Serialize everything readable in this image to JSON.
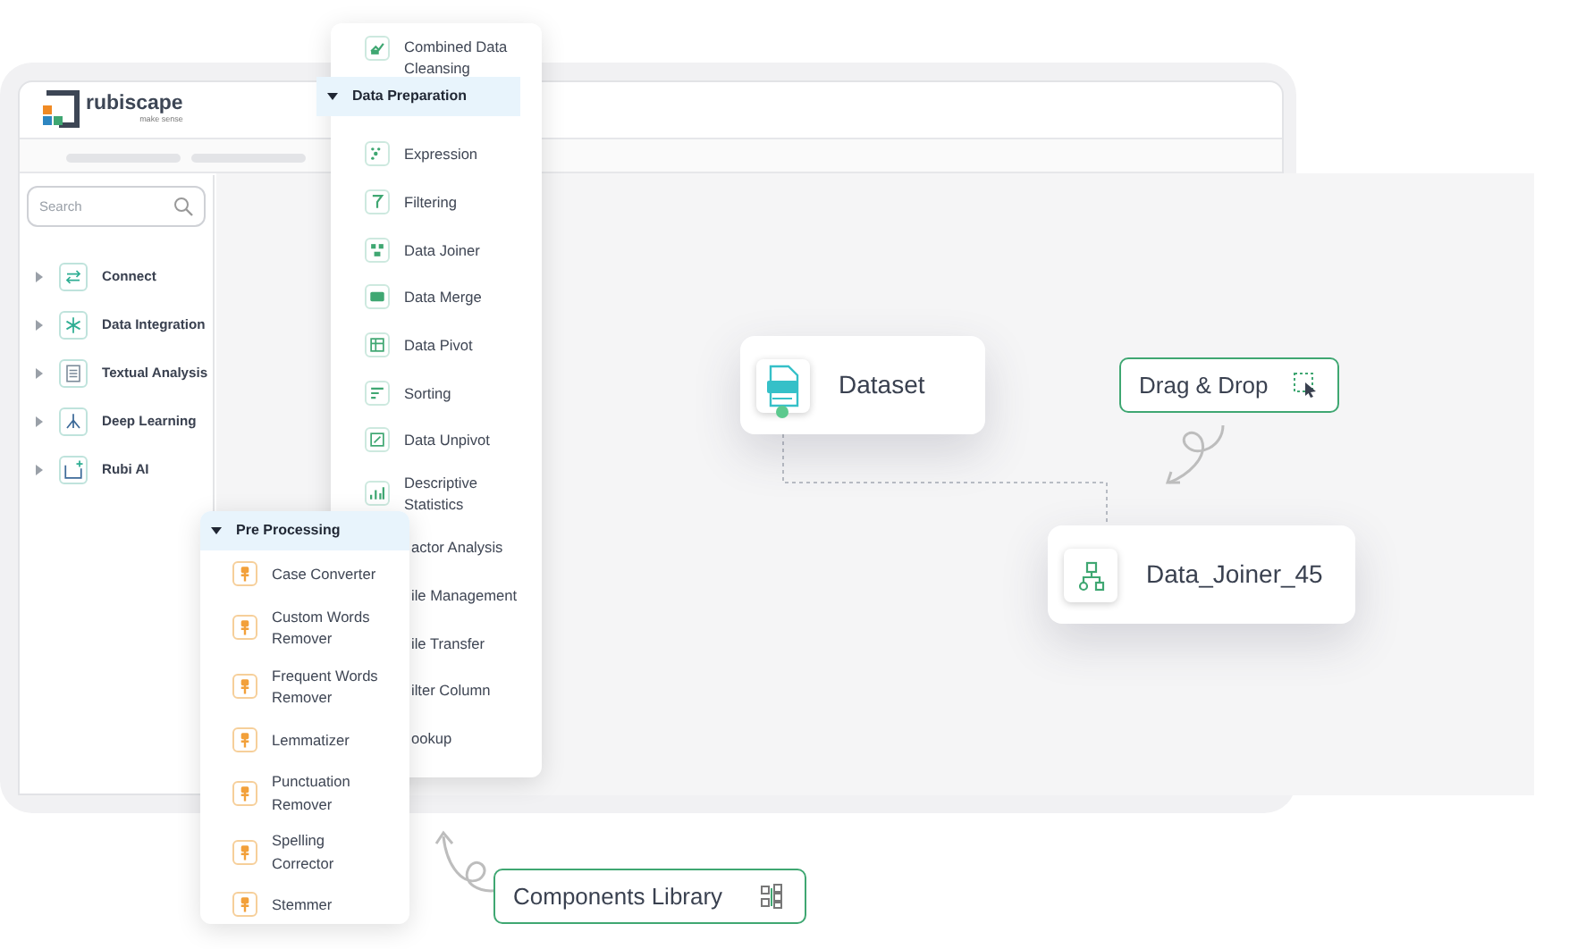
{
  "brand": {
    "name": "rubiscape",
    "tagline": "make sense"
  },
  "sidebar": {
    "search": {
      "placeholder": "Search"
    },
    "items": [
      {
        "label": "Connect",
        "expanded": false
      },
      {
        "label": "Data Integration",
        "expanded": false
      },
      {
        "label": "Textual Analysis",
        "expanded": false
      },
      {
        "label": "Deep Learning",
        "expanded": false
      },
      {
        "label": "Rubi AI",
        "expanded": false
      }
    ]
  },
  "data_preparation": {
    "first_item": "Combined Data Cleansing",
    "title": "Data Preparation",
    "expanded": true,
    "items": [
      {
        "label": "Expression",
        "kind": "tool"
      },
      {
        "label": "Filtering",
        "kind": "tool"
      },
      {
        "label": "Data Joiner",
        "kind": "tool"
      },
      {
        "label": "Data Merge",
        "kind": "tool"
      },
      {
        "label": "Data Pivot",
        "kind": "tool"
      },
      {
        "label": "Sorting",
        "kind": "tool"
      },
      {
        "label": "Data Unpivot",
        "kind": "tool"
      },
      {
        "label": "Descriptive Statistics",
        "kind": "tool"
      },
      {
        "label": "actor Analysis",
        "kind": "covered"
      },
      {
        "label": "ile Management",
        "kind": "covered"
      },
      {
        "label": "ile Transfer",
        "kind": "covered"
      },
      {
        "label": "ilter Column",
        "kind": "covered"
      },
      {
        "label": "ookup",
        "kind": "covered"
      }
    ]
  },
  "pre_processing": {
    "title": "Pre Processing",
    "expanded": true,
    "items": [
      {
        "label": "Case Converter"
      },
      {
        "label": "Custom Words Remover"
      },
      {
        "label": "Frequent Words Remover"
      },
      {
        "label": "Lemmatizer"
      },
      {
        "label": "Punctuation Remover"
      },
      {
        "label": "Spelling Corrector"
      },
      {
        "label": "Stemmer"
      }
    ]
  },
  "canvas": {
    "nodes": [
      {
        "label": "Dataset"
      },
      {
        "label": "Data_Joiner_45"
      }
    ]
  },
  "hints": [
    {
      "label": "Drag & Drop"
    },
    {
      "label": "Components Library"
    }
  ]
}
